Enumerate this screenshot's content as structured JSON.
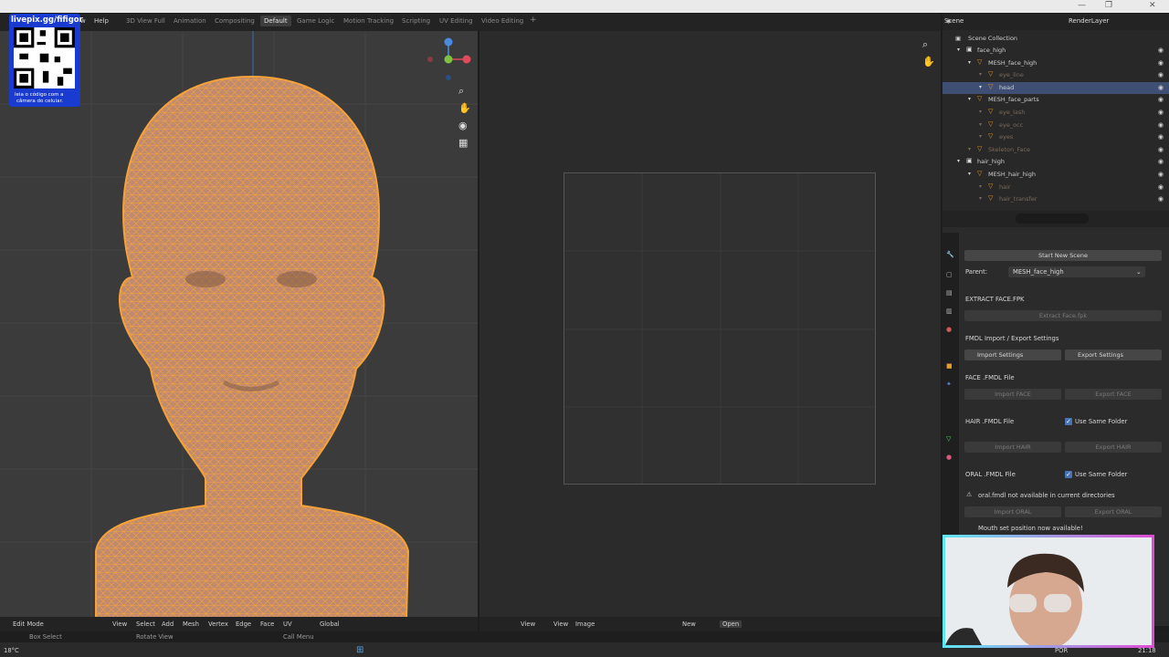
{
  "overlay": {
    "qr_title": "livepix.gg/fifigor",
    "qr_caption_line1": "leia o código com a",
    "qr_caption_line2": "câmera do celular."
  },
  "topbar": {
    "menu_help": "Help",
    "menu_window_fragment": "w",
    "workspaces": [
      "3D View Full",
      "Animation",
      "Compositing",
      "Default",
      "Game Logic",
      "Motion Tracking",
      "Scripting",
      "UV Editing",
      "Video Editing"
    ],
    "active_workspace": "Default",
    "add_workspace": "+",
    "scene_label": "Scene",
    "view_layer_label": "RenderLayer"
  },
  "outliner": {
    "title": "Scene Collection",
    "rows": [
      {
        "label": "face_high",
        "indent": 1,
        "kind": "collection"
      },
      {
        "label": "MESH_face_high",
        "indent": 2,
        "kind": "object"
      },
      {
        "label": "eye_line",
        "indent": 3,
        "kind": "dim"
      },
      {
        "label": "head",
        "indent": 3,
        "kind": "selected"
      },
      {
        "label": "MESH_face_parts",
        "indent": 2,
        "kind": "object"
      },
      {
        "label": "eye_lash",
        "indent": 3,
        "kind": "dim"
      },
      {
        "label": "eye_occ",
        "indent": 3,
        "kind": "dim"
      },
      {
        "label": "eyes",
        "indent": 3,
        "kind": "dim"
      },
      {
        "label": "Skeleton_Face",
        "indent": 2,
        "kind": "dim"
      },
      {
        "label": "hair_high",
        "indent": 1,
        "kind": "collection"
      },
      {
        "label": "MESH_hair_high",
        "indent": 2,
        "kind": "object"
      },
      {
        "label": "hair",
        "indent": 3,
        "kind": "dim"
      },
      {
        "label": "hair_transfer",
        "indent": 3,
        "kind": "dim"
      }
    ]
  },
  "properties": {
    "start_new_scene": "Start New Scene",
    "parent_label": "Parent:",
    "parent_value": "MESH_face_high",
    "extract_title": "EXTRACT FACE.FPK",
    "extract_button": "Extract Face.fpk",
    "fmdl_title": "FMDL Import / Export Settings",
    "import_settings": "Import Settings",
    "export_settings": "Export Settings",
    "face_title": "FACE .FMDL File",
    "import_face": "Import FACE",
    "export_face": "Export FACE",
    "hair_title": "HAIR .FMDL File",
    "use_same_folder": "Use Same Folder",
    "import_hair": "Import HAIR",
    "export_hair": "Export HAIR",
    "oral_title": "ORAL .FMDL File",
    "oral_warning": "oral.fmdl not available in current directories",
    "import_oral": "Import ORAL",
    "export_oral": "Export ORAL",
    "mouth_note": "Mouth set position now available!"
  },
  "bottom3d": {
    "mode": "Edit Mode",
    "view": "View",
    "select": "Select",
    "add": "Add",
    "mesh": "Mesh",
    "vertex": "Vertex",
    "edge": "Edge",
    "face": "Face",
    "uv": "UV",
    "orientation": "Global"
  },
  "bottomimg": {
    "view": "View",
    "view2": "View",
    "image": "Image",
    "new": "New",
    "open": "Open"
  },
  "statusbar": {
    "box_select": "Box Select",
    "rotate_view": "Rotate View",
    "call_menu": "Call Menu"
  },
  "taskbar": {
    "temperature": "18°C",
    "language": "POR",
    "time": "21:18"
  },
  "colors": {
    "wire": "#f5a23a",
    "selection": "#3e4f73",
    "accent": "#4772b3",
    "skin": "#c08a6e"
  }
}
